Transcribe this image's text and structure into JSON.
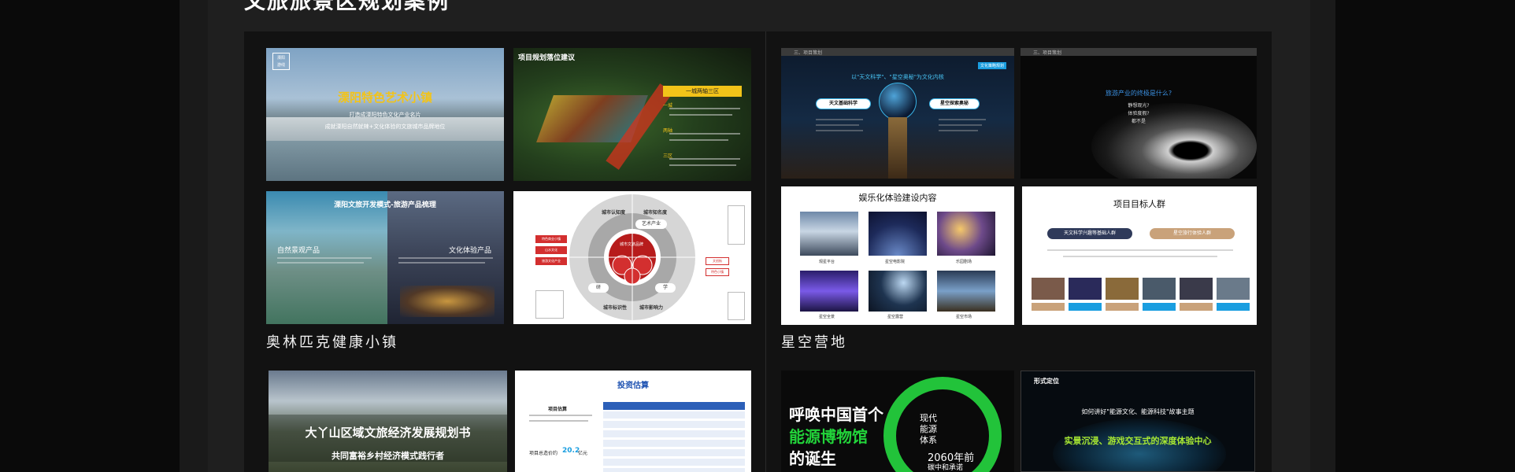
{
  "heading": "文旅旅景区规划案例",
  "cases": [
    {
      "name": "奥林匹克健康小镇",
      "slides": [
        {
          "logo": "溧阳\n游线",
          "title": "溧阳特色艺术小镇",
          "line1": "打造成溧阳特色文化产业名片",
          "line2": "成就溧阳自然就辣+文化体验的文旅城市品牌地位"
        },
        {
          "title": "项目规划落位建议",
          "tag": "一城两轴三区",
          "bullets": [
            "一城",
            "两轴",
            "三区"
          ]
        },
        {
          "title": "溧阳文旅开发模式-旅游产品梳理",
          "left_head": "自然景观产品",
          "right_head": "文化体验产品"
        },
        {
          "center": "城市文旅品牌",
          "ring_top_left": "城市认知度",
          "ring_top_right": "城市知名度",
          "ring_bottom_left": "城市标识性",
          "ring_bottom_right": "城市影响力",
          "pill1": "艺术产业",
          "pill2": "研",
          "pill3": "学",
          "left_boxes": [
            "特色商业小镇",
            "山水文化",
            "旅游文化产业"
          ],
          "right_boxes": [
            "文创街",
            "特色小镇"
          ]
        }
      ]
    },
    {
      "name": "星空营地",
      "slides": [
        {
          "section": "三、项目策划",
          "subtitle": "以\"天文科学\"、\"星空奥秘\"为文化内核",
          "badge": "文化策略规划",
          "left_node": "天文基础科学",
          "right_node": "星空探索奥秘"
        },
        {
          "section": "三、项目策划",
          "question": "旅游产业的终极是什么?",
          "lines": [
            "静想观光?",
            "体验度假?",
            "都不是"
          ]
        },
        {
          "title": "娱乐化体验建设内容",
          "captions": [
            "观星平台",
            "星空电影院",
            "乐园剧场",
            "星空全景",
            "星空露营",
            "星空市场"
          ]
        },
        {
          "title": "项目目标人群",
          "pill_left": "天文科学兴趣等基础人群",
          "pill_right": "星空旅行体验人群"
        }
      ]
    },
    {
      "name": "",
      "slides": [
        {
          "title": "大丫山区域文旅经济发展规划书",
          "subtitle": "共同富裕乡村经济模式践行者"
        },
        {
          "title": "投资估算",
          "label1": "项目估算",
          "label2": "项目总造价约",
          "value": "20.2",
          "unit": "亿元"
        }
      ]
    },
    {
      "name": "",
      "slides": [
        {
          "line1": "呼唤中国首个",
          "line2": "能源博物馆",
          "line3": "的诞生",
          "mid1": "现代",
          "mid2": "能源",
          "mid3": "体系",
          "year": "2060年前",
          "year_sub": "碳中和承诺"
        },
        {
          "label": "形式定位",
          "question": "如何讲好\"能源文化、能源科技\"故事主题",
          "answer": "实景沉浸、游戏交互式的深度体验中心"
        }
      ]
    }
  ]
}
